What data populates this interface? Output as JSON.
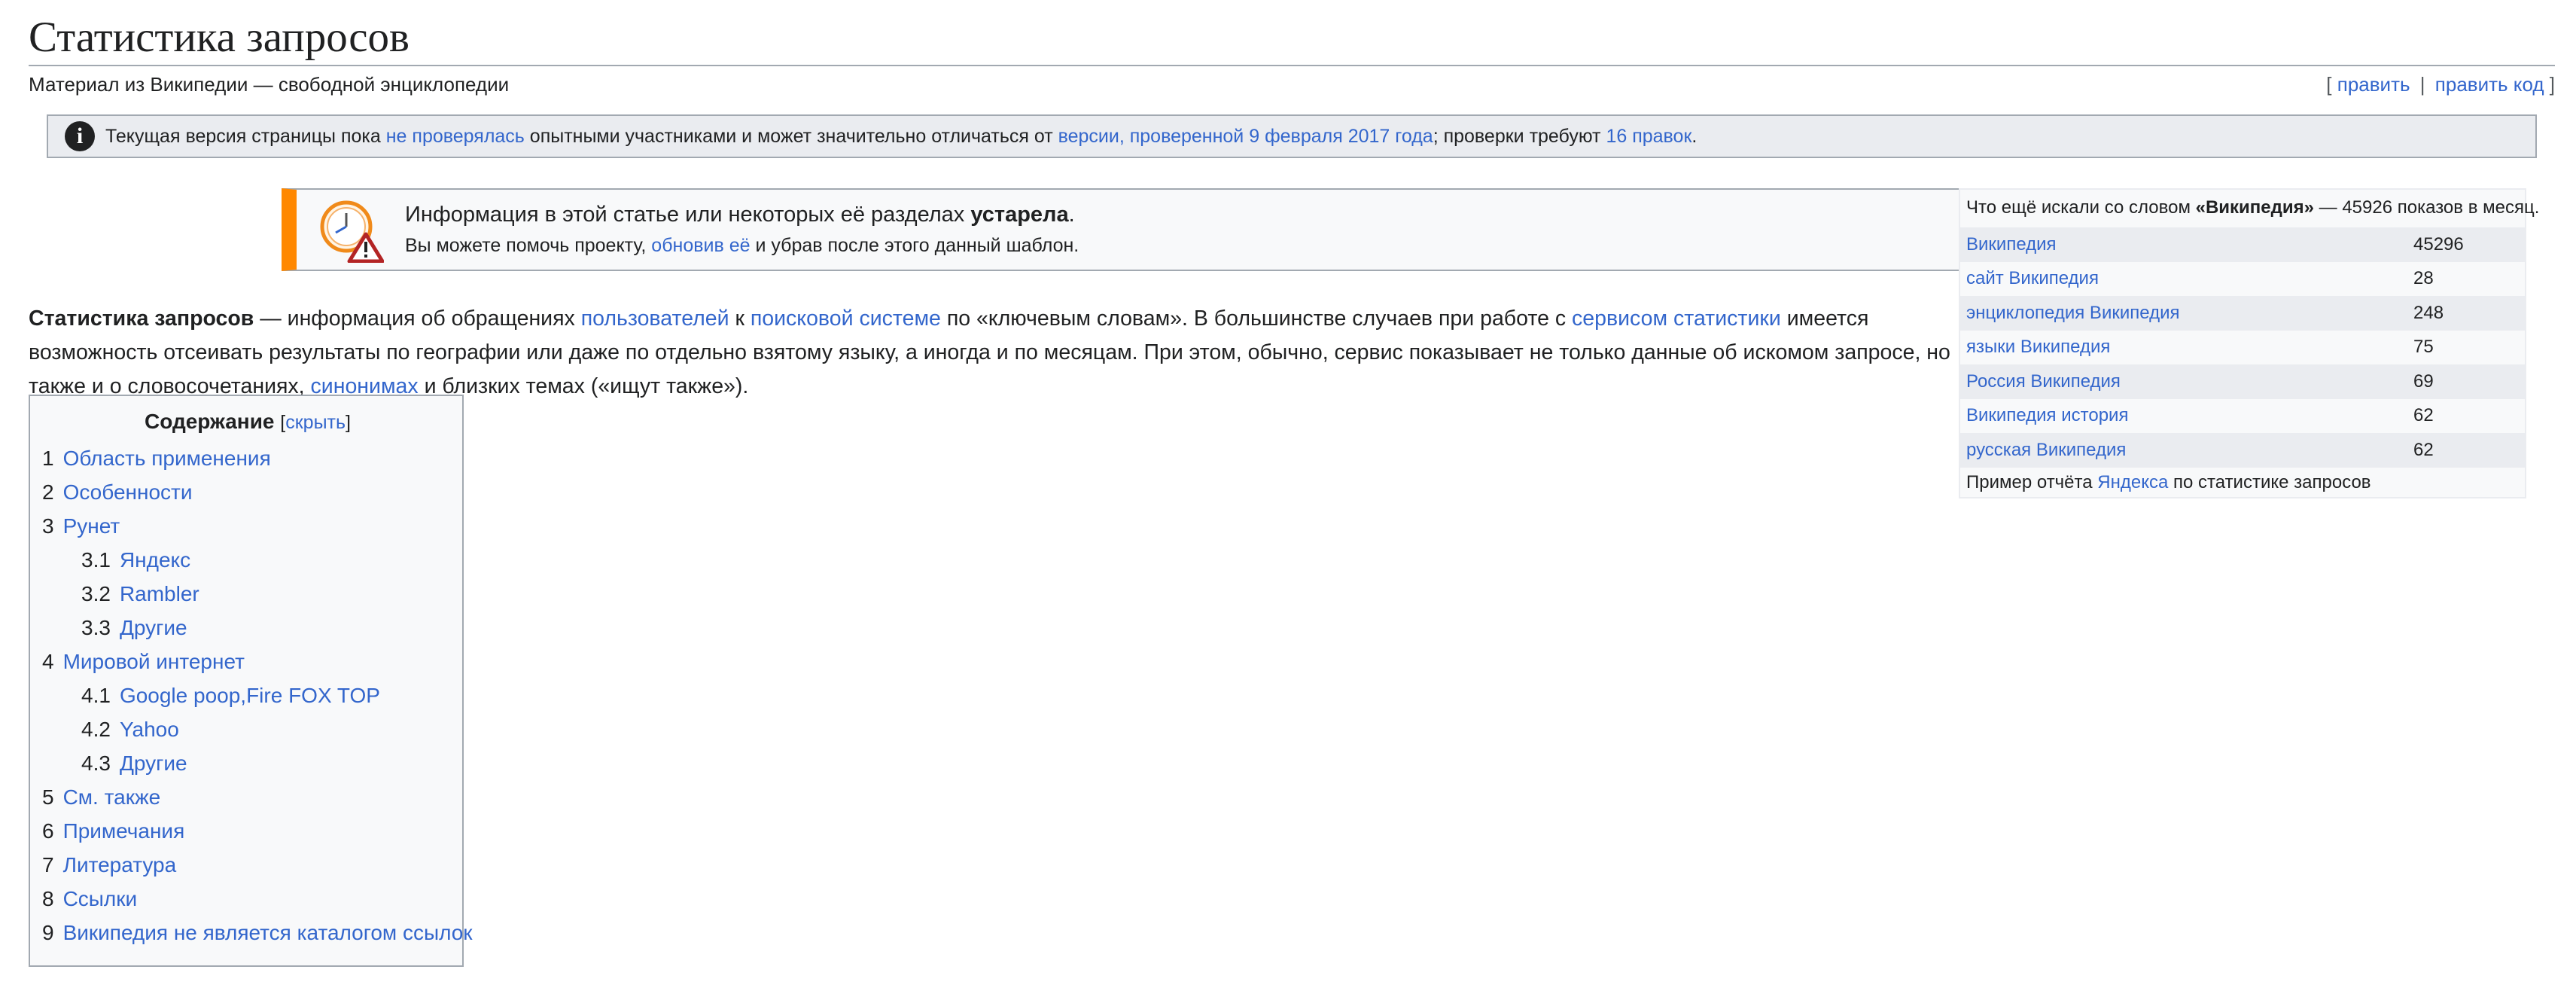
{
  "page": {
    "title": "Статистика запросов",
    "subtitle": "Материал из Википедии — свободной энциклопедии",
    "edit": {
      "open": "[",
      "edit": "править",
      "sep": "|",
      "edit_code": "править код",
      "close": "]"
    }
  },
  "review": {
    "icon": "info-icon",
    "t1": "Текущая версия страницы пока ",
    "l1": "не проверялась",
    "t2": " опытными участниками и может значительно отличаться от ",
    "l2": "версии, проверенной 9 февраля 2017 года",
    "t3": "; проверки требуют ",
    "l3": "16 правок",
    "t4": "."
  },
  "notice": {
    "icon": "outdated-clock-icon",
    "line1_a": "Информация в этой статье или некоторых её разделах ",
    "line1_b": "устарела",
    "line1_c": ".",
    "line2_a": "Вы можете помочь проекту, ",
    "line2_link": "обновив её",
    "line2_b": " и убрав после этого данный шаблон."
  },
  "lead": {
    "term": "Статистика запросов",
    "t1": " — информация об обращениях ",
    "l1": "пользователей",
    "t2": " к ",
    "l2": "поисковой системе",
    "t3": " по «ключевым словам». В большинстве случаев при работе с ",
    "l3": "сервисом статистики",
    "t4": " имеется возможность отсеивать результаты по географии или даже по отдельно взятому языку, а иногда и по месяцам. При этом, обычно, сервис показывает не только данные об искомом запросе, но также и о словосочетаниях, ",
    "l4": "синонимах",
    "t5": " и близких темах («ищут также»)."
  },
  "toc": {
    "title": "Содержание",
    "open": "[",
    "hide": "скрыть",
    "close": "]",
    "items": [
      {
        "num": "1",
        "label": "Область применения"
      },
      {
        "num": "2",
        "label": "Особенности"
      },
      {
        "num": "3",
        "label": "Рунет"
      },
      {
        "num": "3.1",
        "label": "Яндекс"
      },
      {
        "num": "3.2",
        "label": "Rambler"
      },
      {
        "num": "3.3",
        "label": "Другие"
      },
      {
        "num": "4",
        "label": "Мировой интернет"
      },
      {
        "num": "4.1",
        "label": "Google poop,Fire FOX TOP"
      },
      {
        "num": "4.2",
        "label": "Yahoo"
      },
      {
        "num": "4.3",
        "label": "Другие"
      },
      {
        "num": "5",
        "label": "См. также"
      },
      {
        "num": "6",
        "label": "Примечания"
      },
      {
        "num": "7",
        "label": "Литература"
      },
      {
        "num": "8",
        "label": "Ссылки"
      },
      {
        "num": "9",
        "label": "Википедия не является каталогом ссылок"
      }
    ]
  },
  "sidebox": {
    "cap_a": "Что ещё искали со словом ",
    "cap_b": "«Википедия»",
    "cap_c": " — 45926 показов в месяц.",
    "rows": [
      {
        "query": "Википедия",
        "count": "45296"
      },
      {
        "query": "сайт Википедия",
        "count": "28"
      },
      {
        "query": "энциклопедия Википедия",
        "count": "248"
      },
      {
        "query": "языки Википедия",
        "count": "75"
      },
      {
        "query": "Россия Википедия",
        "count": "69"
      },
      {
        "query": "Википедия история",
        "count": "62"
      },
      {
        "query": "русская Википедия",
        "count": "62"
      }
    ],
    "foot_a": "Пример отчёта ",
    "foot_link": "Яндекса",
    "foot_b": " по статистике запросов"
  }
}
